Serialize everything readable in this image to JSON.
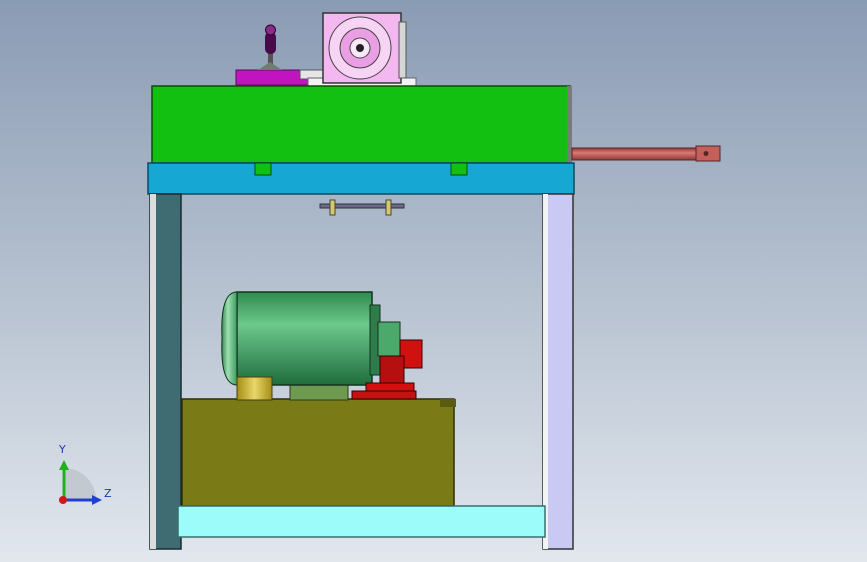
{
  "axes": {
    "y_label": "Y",
    "z_label": "Z"
  },
  "colors": {
    "frame_top": "#16a7d3",
    "box": "#12c012",
    "bottom_shelf": "#9bfcfa",
    "tank": "#7a7a17",
    "motor": "#3aa660",
    "pump": "#d11010",
    "pipe": "#b8514d",
    "flange": "#f4b8f0",
    "lever_base": "#c014c0"
  }
}
